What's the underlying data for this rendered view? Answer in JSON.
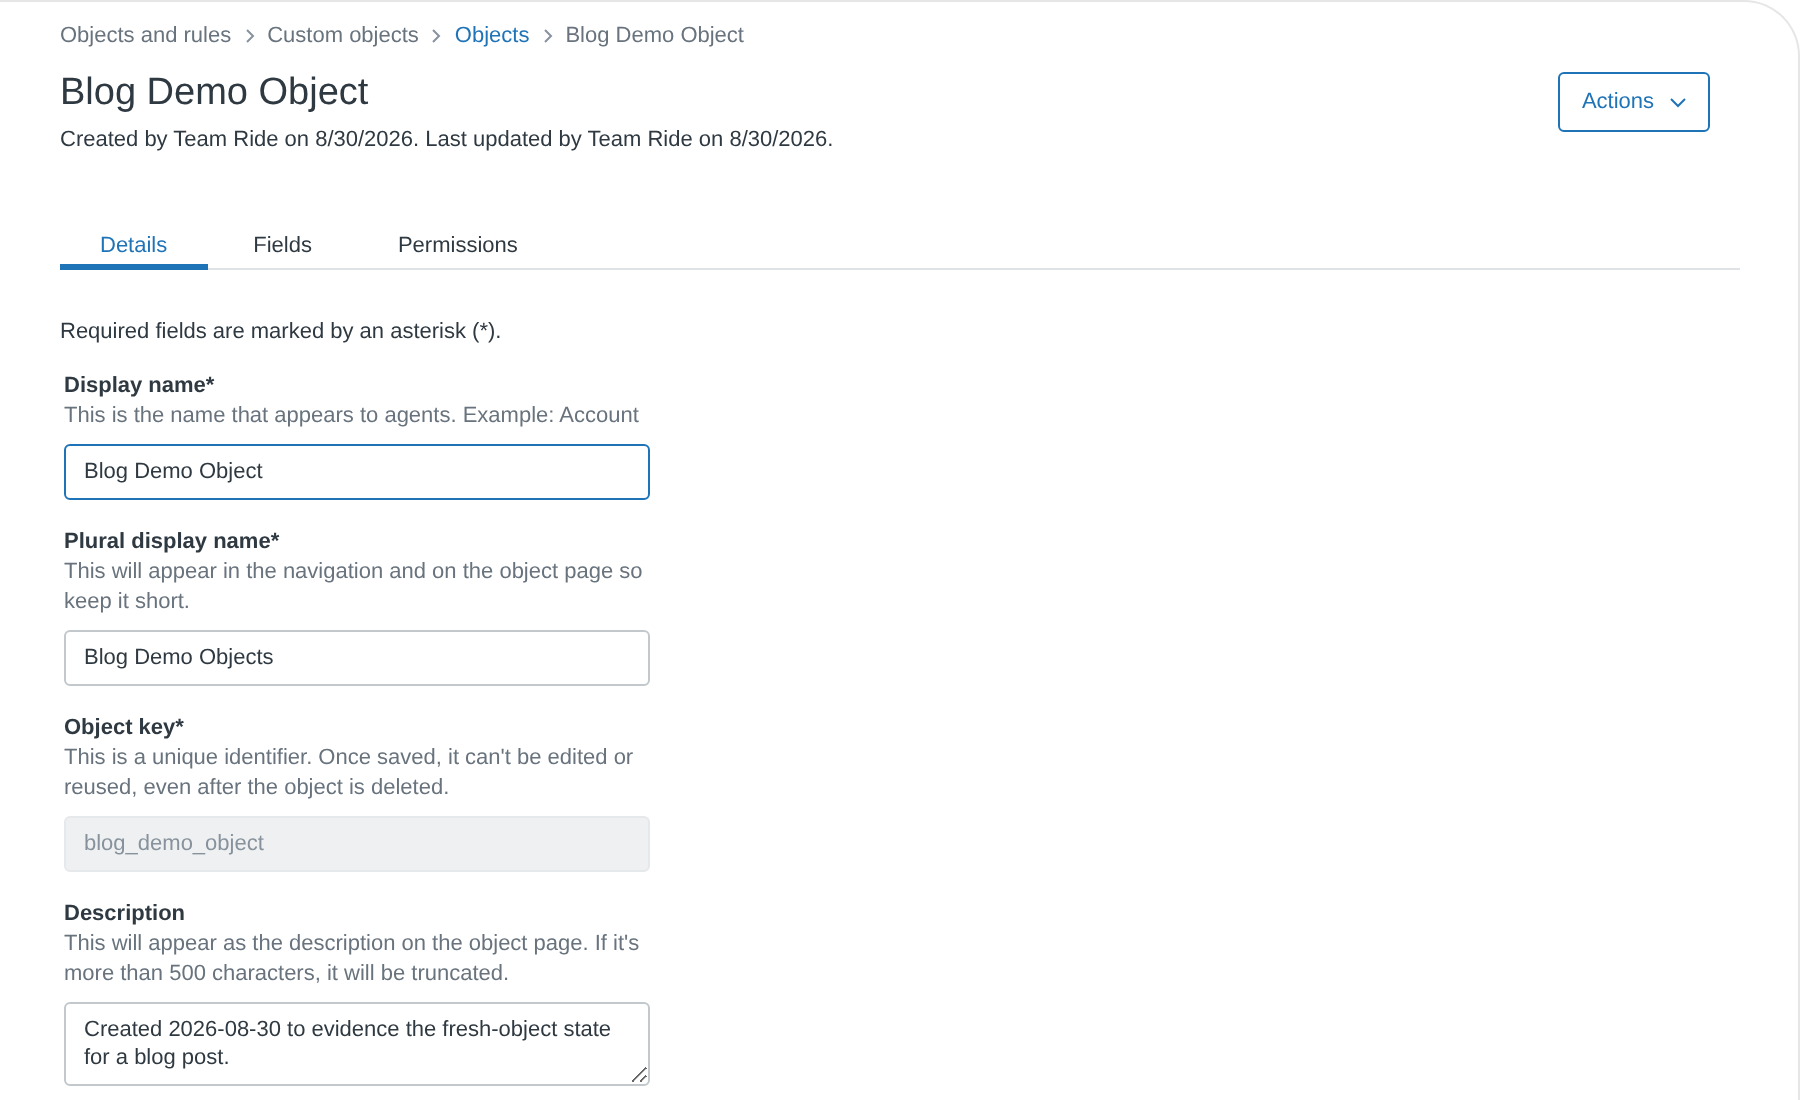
{
  "breadcrumb": [
    {
      "label": "Objects and rules",
      "link": false
    },
    {
      "label": "Custom objects",
      "link": false
    },
    {
      "label": "Objects",
      "link": true
    },
    {
      "label": "Blog Demo Object",
      "link": false
    }
  ],
  "title": "Blog Demo Object",
  "subtitle": "Created by Team Ride on 8/30/2026. Last updated by Team Ride on 8/30/2026.",
  "actions_button": "Actions",
  "tabs": [
    {
      "label": "Details",
      "selected": true
    },
    {
      "label": "Fields",
      "selected": false
    },
    {
      "label": "Permissions",
      "selected": false
    }
  ],
  "required_note": "Required fields are marked by an asterisk (*).",
  "fields": [
    {
      "kind": "input",
      "label": "Display name*",
      "help": "This is the name that appears to agents. Example: Account",
      "value": "Blog Demo Object",
      "focused": true,
      "disabled": false
    },
    {
      "kind": "input",
      "label": "Plural display name*",
      "help": "This will appear in the navigation and on the object page so keep it short.",
      "value": "Blog Demo Objects",
      "focused": false,
      "disabled": false
    },
    {
      "kind": "input",
      "label": "Object key*",
      "help": "This is a unique identifier. Once saved, it can't be edited or reused, even after the object is deleted.",
      "value": "blog_demo_object",
      "focused": false,
      "disabled": true
    },
    {
      "kind": "textarea",
      "label": "Description",
      "help": "This will appear as the description on the object page. If it's more than 500 characters, it will be truncated.",
      "value": "Created 2026-08-30 to evidence the fresh-object state for a blog post.",
      "focused": false,
      "disabled": false
    }
  ]
}
